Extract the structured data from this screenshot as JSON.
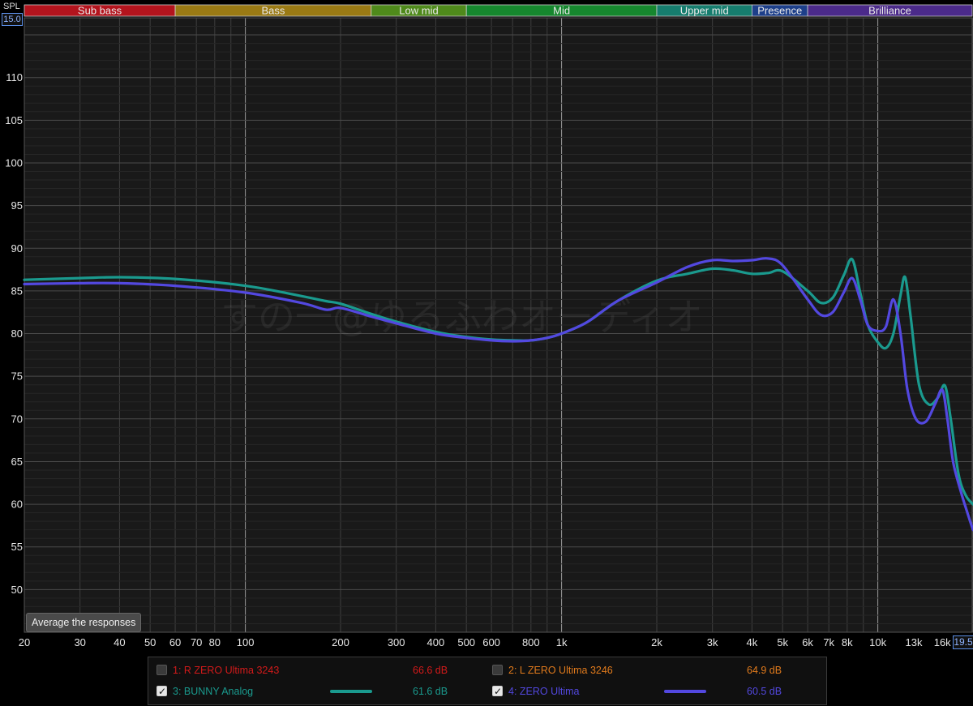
{
  "header": {
    "spl_label": "SPL",
    "y_top_value": "15.0"
  },
  "bands": [
    {
      "name": "Sub bass",
      "from": 20,
      "to": 60,
      "color": "#b3141d"
    },
    {
      "name": "Bass",
      "from": 60,
      "to": 250,
      "color": "#9a7a14"
    },
    {
      "name": "Low mid",
      "from": 250,
      "to": 500,
      "color": "#4f8a1b"
    },
    {
      "name": "Mid",
      "from": 500,
      "to": 2000,
      "color": "#16872e"
    },
    {
      "name": "Upper mid",
      "from": 2000,
      "to": 4000,
      "color": "#167d6e"
    },
    {
      "name": "Presence",
      "from": 4000,
      "to": 6000,
      "color": "#1d3f8a"
    },
    {
      "name": "Brilliance",
      "from": 6000,
      "to": 20000,
      "color": "#4b2a8a"
    }
  ],
  "watermark": "すの一@ゆるふわオーディオ",
  "buttons": {
    "average": "Average the responses"
  },
  "x_end_value": "19.5",
  "chart_data": {
    "type": "line",
    "xscale": "log",
    "xlim": [
      20,
      20000
    ],
    "ylim": [
      45,
      117
    ],
    "x_ticks": [
      {
        "v": 20,
        "label": "20"
      },
      {
        "v": 30,
        "label": "30"
      },
      {
        "v": 40,
        "label": "40"
      },
      {
        "v": 50,
        "label": "50"
      },
      {
        "v": 60,
        "label": "60"
      },
      {
        "v": 70,
        "label": "70"
      },
      {
        "v": 80,
        "label": "80"
      },
      {
        "v": 100,
        "label": "100"
      },
      {
        "v": 200,
        "label": "200"
      },
      {
        "v": 300,
        "label": "300"
      },
      {
        "v": 400,
        "label": "400"
      },
      {
        "v": 500,
        "label": "500"
      },
      {
        "v": 600,
        "label": "600"
      },
      {
        "v": 800,
        "label": "800"
      },
      {
        "v": 1000,
        "label": "1k"
      },
      {
        "v": 2000,
        "label": "2k"
      },
      {
        "v": 3000,
        "label": "3k"
      },
      {
        "v": 4000,
        "label": "4k"
      },
      {
        "v": 5000,
        "label": "5k"
      },
      {
        "v": 6000,
        "label": "6k"
      },
      {
        "v": 7000,
        "label": "7k"
      },
      {
        "v": 8000,
        "label": "8k"
      },
      {
        "v": 10000,
        "label": "10k"
      },
      {
        "v": 13000,
        "label": "13k",
        "dim": true
      },
      {
        "v": 16000,
        "label": "16k",
        "dim": true
      }
    ],
    "y_ticks": [
      50,
      55,
      60,
      65,
      70,
      75,
      80,
      85,
      90,
      95,
      100,
      105,
      110
    ],
    "grid": true,
    "series": [
      {
        "name": "BUNNY Analog",
        "color": "#1a9a8e",
        "x": [
          20,
          30,
          40,
          60,
          100,
          150,
          180,
          200,
          250,
          300,
          400,
          500,
          600,
          700,
          800,
          900,
          1000,
          1200,
          1500,
          2000,
          2500,
          3000,
          3500,
          4000,
          4500,
          5000,
          6000,
          6600,
          7200,
          7800,
          8300,
          8800,
          9300,
          10000,
          10600,
          11200,
          11800,
          12200,
          12700,
          13500,
          14500,
          15500,
          16300,
          17000,
          18000,
          19000,
          20000
        ],
        "y": [
          86.3,
          86.5,
          86.6,
          86.4,
          85.6,
          84.4,
          83.8,
          83.5,
          82.3,
          81.4,
          80.2,
          79.6,
          79.3,
          79.2,
          79.2,
          79.5,
          80.0,
          81.3,
          83.8,
          86.2,
          87.0,
          87.6,
          87.4,
          87.0,
          87.1,
          87.3,
          85.0,
          83.6,
          84.2,
          86.8,
          88.7,
          84.8,
          81.0,
          79.0,
          78.3,
          80.0,
          84.5,
          86.6,
          82.0,
          74.0,
          71.7,
          72.5,
          73.9,
          70.0,
          63.5,
          61.0,
          60.0
        ]
      },
      {
        "name": "ZERO Ultima",
        "color": "#5348e0",
        "x": [
          20,
          30,
          40,
          60,
          100,
          150,
          180,
          200,
          250,
          300,
          400,
          500,
          600,
          700,
          800,
          900,
          1000,
          1200,
          1500,
          2000,
          2500,
          3000,
          3500,
          4000,
          4500,
          5000,
          6000,
          6600,
          7200,
          7800,
          8300,
          8800,
          9300,
          10000,
          10600,
          11200,
          11800,
          12400,
          13200,
          14200,
          15200,
          16000,
          16600,
          17300,
          18300,
          19200,
          20000
        ],
        "y": [
          85.8,
          85.9,
          85.9,
          85.6,
          84.8,
          83.6,
          82.8,
          83.0,
          82.0,
          81.2,
          80.0,
          79.5,
          79.2,
          79.1,
          79.2,
          79.5,
          80.0,
          81.3,
          83.8,
          86.0,
          87.8,
          88.6,
          88.5,
          88.6,
          88.8,
          88.0,
          84.0,
          82.2,
          82.5,
          84.8,
          86.5,
          84.0,
          81.0,
          80.3,
          80.8,
          84.0,
          80.0,
          73.5,
          70.0,
          69.7,
          71.8,
          73.4,
          70.0,
          65.0,
          61.5,
          59.0,
          57.0
        ]
      }
    ]
  },
  "legend": {
    "items": [
      {
        "label": "1: R ZERO Ultima 3243",
        "value": "66.6 dB",
        "color": "#d21a1a",
        "checked": false
      },
      {
        "label": "2: L ZERO Ultima 3246",
        "value": "64.9 dB",
        "color": "#e07a1c",
        "checked": false
      },
      {
        "label": "3: BUNNY Analog",
        "value": "61.6 dB",
        "color": "#1a9a8e",
        "checked": true
      },
      {
        "label": "4: ZERO Ultima",
        "value": "60.5 dB",
        "color": "#5348e0",
        "checked": true
      }
    ]
  }
}
